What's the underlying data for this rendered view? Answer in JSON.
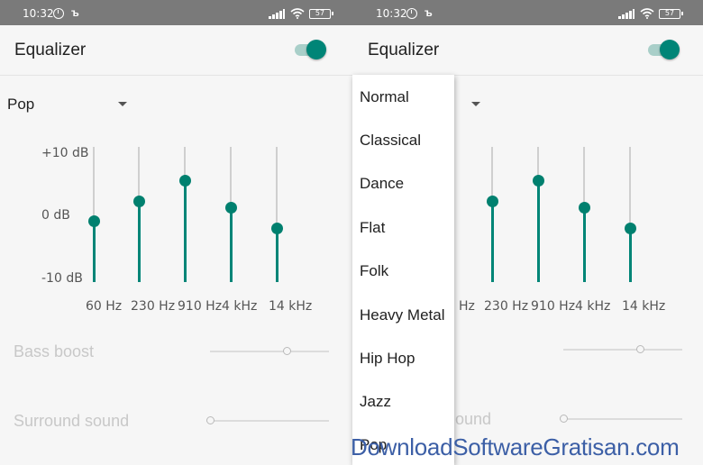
{
  "status_bar": {
    "time": "10:32",
    "battery": "57",
    "notification_glyph": "ъ"
  },
  "app": {
    "title": "Equalizer",
    "toggle_on": true,
    "accent_color": "#008577"
  },
  "preset": {
    "selected": "Pop"
  },
  "equalizer": {
    "range_labels": [
      "+10 dB",
      "0 dB",
      "-10 dB"
    ],
    "bands": [
      {
        "label": "60 Hz",
        "level_fraction": 0.45
      },
      {
        "label": "230 Hz",
        "level_fraction": 0.6
      },
      {
        "label": "910 Hz",
        "level_fraction": 0.75
      },
      {
        "label": "4 kHz",
        "level_fraction": 0.55
      },
      {
        "label": "14 kHz",
        "level_fraction": 0.4
      }
    ]
  },
  "settings": {
    "bass_boost": {
      "label": "Bass boost",
      "level_fraction": 0.66,
      "enabled": false
    },
    "surround_sound": {
      "label": "Surround sound",
      "level_fraction": 0.0,
      "enabled": false
    }
  },
  "preset_menu": {
    "options": [
      "Normal",
      "Classical",
      "Dance",
      "Flat",
      "Folk",
      "Heavy Metal",
      "Hip Hop",
      "Jazz",
      "Pop"
    ]
  },
  "watermark": "DownloadSoftwareGratisan.com",
  "icons": [
    "alarm-icon",
    "signal-icon",
    "wifi-icon",
    "battery-icon",
    "dropdown-arrow-icon"
  ]
}
